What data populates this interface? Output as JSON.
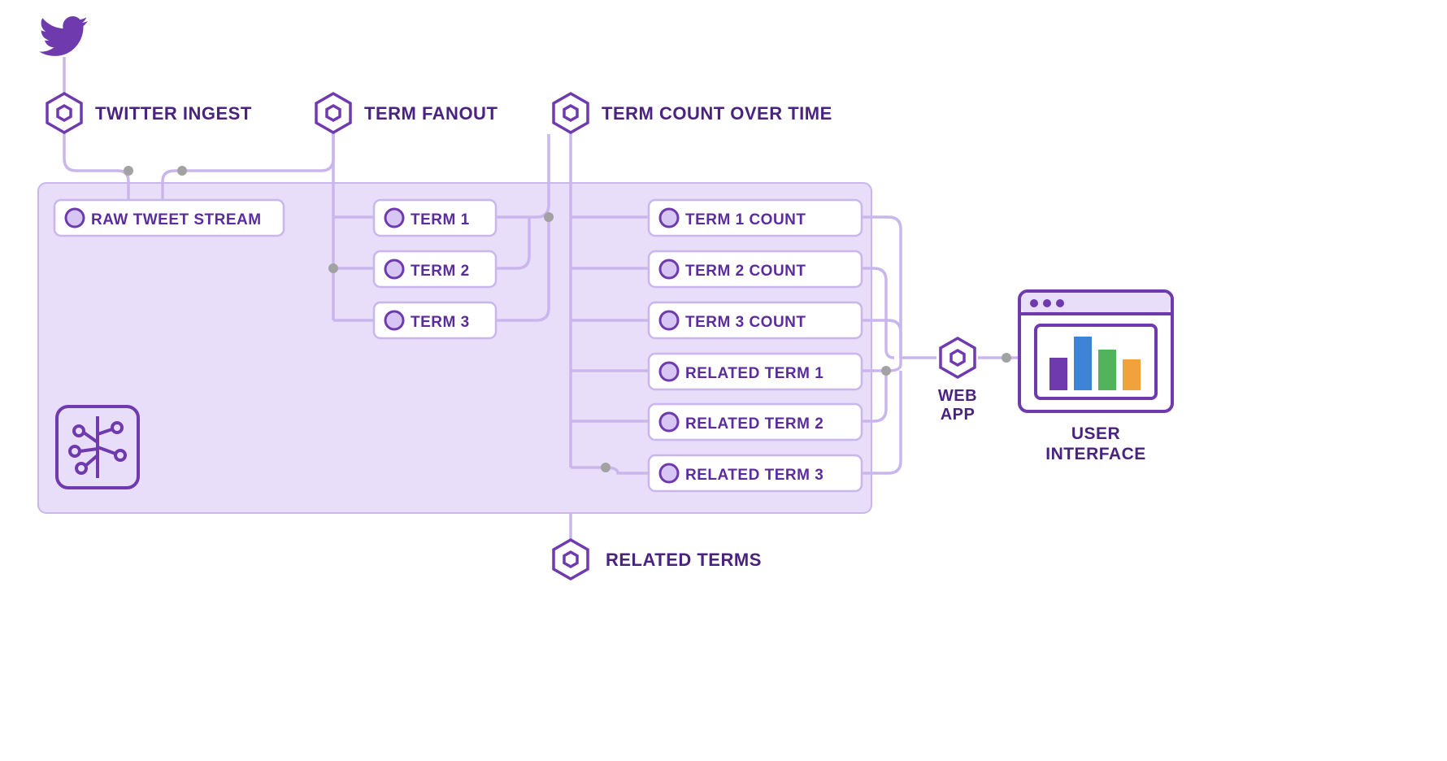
{
  "services": {
    "twitter_ingest": "TWITTER INGEST",
    "term_fanout": "TERM FANOUT",
    "term_count": "TERM COUNT OVER TIME",
    "related_terms": "RELATED TERMS",
    "web_app": "WEB",
    "web_app2": "APP"
  },
  "topics": {
    "raw": "RAW TWEET STREAM",
    "t1": "TERM 1",
    "t2": "TERM 2",
    "t3": "TERM 3",
    "c1": "TERM 1 COUNT",
    "c2": "TERM 2 COUNT",
    "c3": "TERM 3 COUNT",
    "r1": "RELATED TERM 1",
    "r2": "RELATED TERM 2",
    "r3": "RELATED TERM 3"
  },
  "ui": {
    "title1": "USER",
    "title2": "INTERFACE"
  },
  "colors": {
    "purple": "#6e3aae",
    "purpleDark": "#4a2280",
    "lavender": "#e7defb",
    "lavenderLine": "#c9b6ec",
    "grayDot": "#9e9e9e",
    "barBlue": "#3d84d6",
    "barGreen": "#52b45a",
    "barOrange": "#f0a23c"
  }
}
